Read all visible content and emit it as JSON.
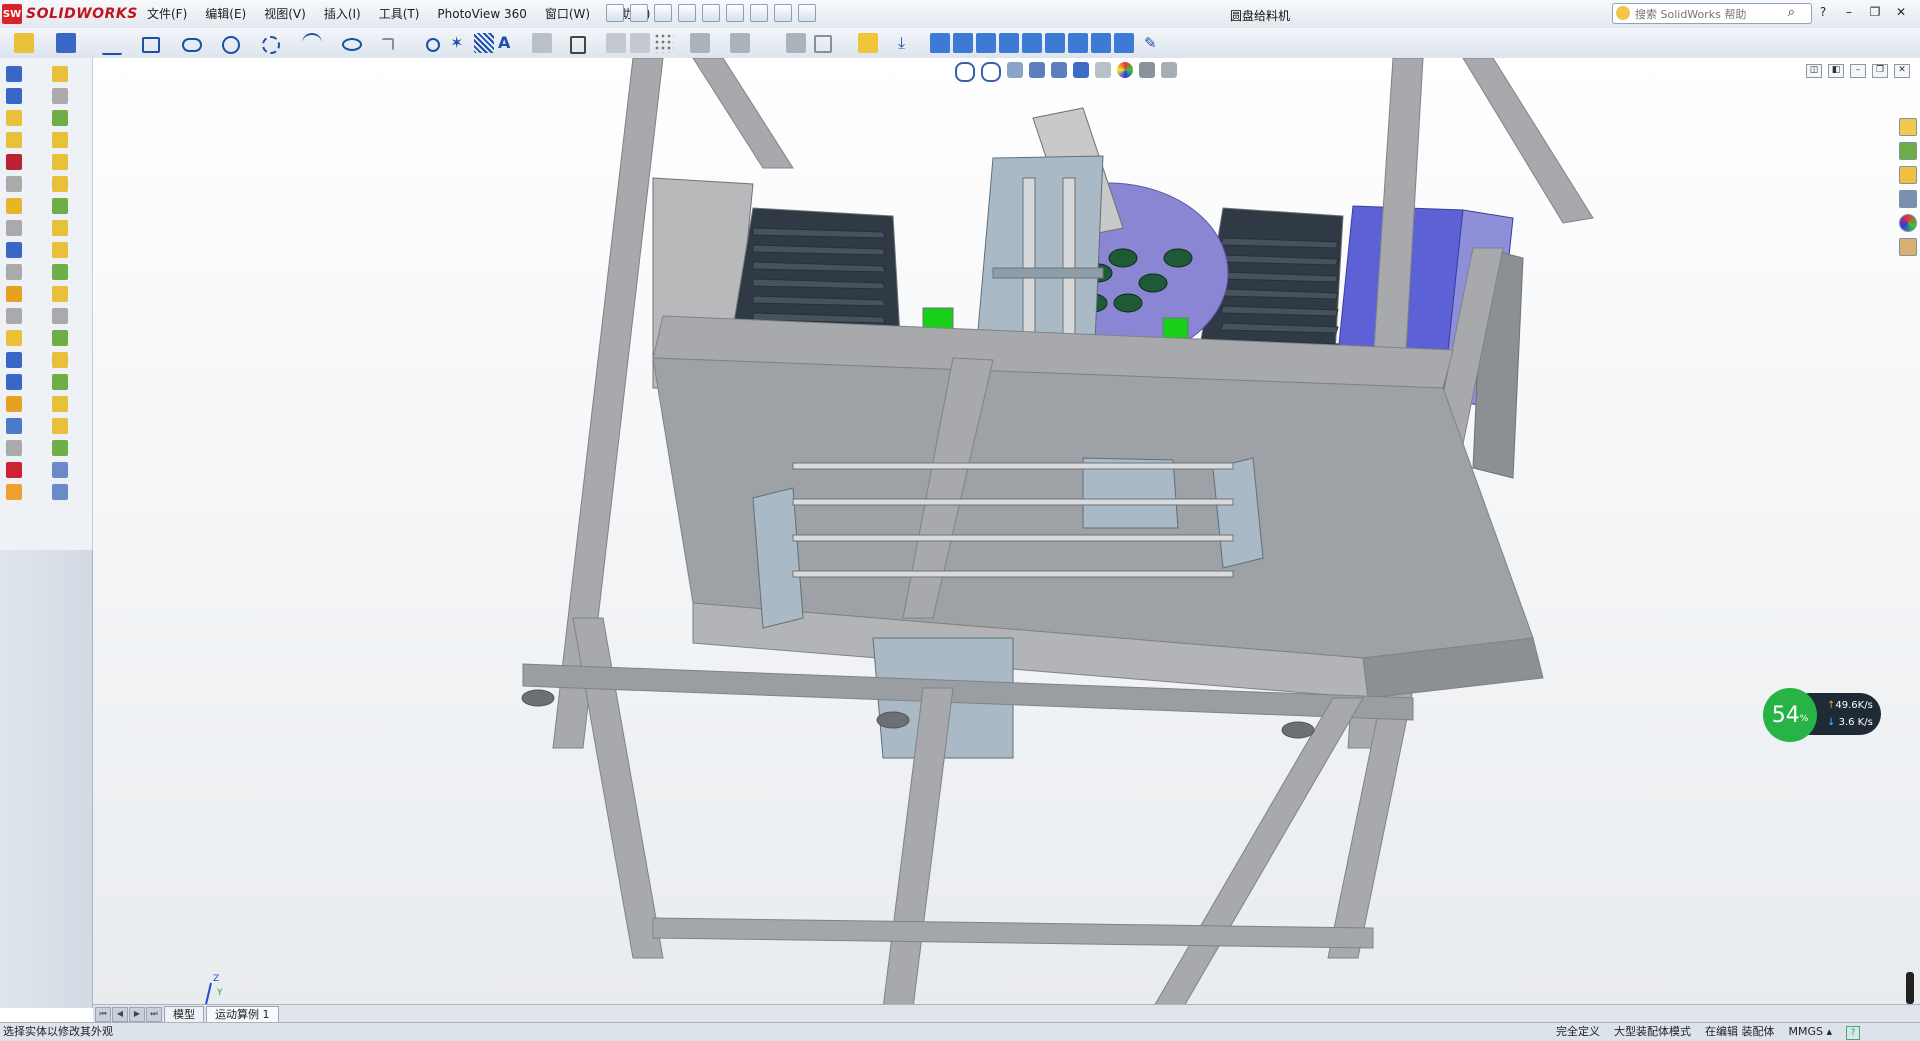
{
  "app": {
    "brand_mark": "SW",
    "brand_name": "SOLIDWORKS"
  },
  "menu": [
    "文件(F)",
    "编辑(E)",
    "视图(V)",
    "插入(I)",
    "工具(T)",
    "PhotoView 360",
    "窗口(W)",
    "帮助(H)"
  ],
  "document_title": "圆盘给料机",
  "search": {
    "placeholder": "搜索 SolidWorks 帮助"
  },
  "window_controls": {
    "minimize": "–",
    "restore": "❐",
    "close": "✕",
    "help": "?"
  },
  "tabs": {
    "model": "模型",
    "motion": "运动算例 1"
  },
  "status": {
    "message": "选择实体以修改其外观",
    "fully_defined": "完全定义",
    "large_assembly": "大型装配体模式",
    "editing": "在编辑 装配体",
    "units": "MMGS",
    "units_arrow": "▴"
  },
  "network": {
    "percent": "54",
    "percent_unit": "%",
    "up": "49.6",
    "down": "3.6",
    "rate_unit": "K/s",
    "up_arrow": "↑",
    "down_arrow": "↓"
  },
  "triad": {
    "x": "X",
    "y": "Y",
    "z": "Z"
  },
  "colors": {
    "frame": "#a7a9ad",
    "frame_dark": "#7f8286",
    "plate": "#a9b9c6",
    "disc": "#8a86d4",
    "blue_hopper": "#5c62d6",
    "accent_green": "#17d017"
  }
}
